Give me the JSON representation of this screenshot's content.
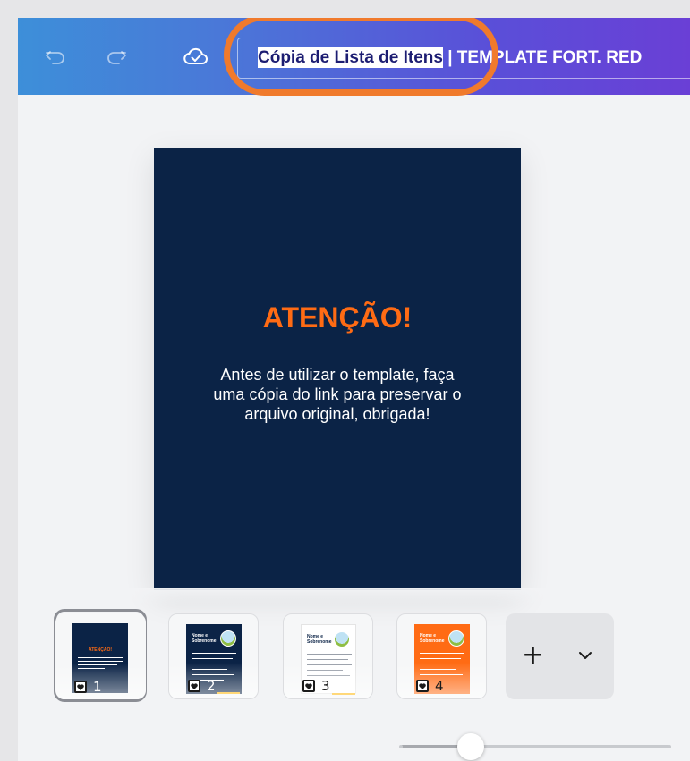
{
  "toolbar": {
    "undo_icon": "undo-icon",
    "redo_icon": "redo-icon",
    "cloud_icon": "cloud-check-icon",
    "title_selected": "Cópia de Lista de Itens",
    "title_rest": " | TEMPLATE FORT. RED"
  },
  "page": {
    "heading": "ATENÇÃO!",
    "body": "Antes de utilizar o template, faça uma cópia do link para preservar o arquivo original, obrigada!"
  },
  "thumbnails": [
    {
      "number": "1",
      "mini_title": "ATENÇÃO!",
      "selected": true
    },
    {
      "number": "2",
      "mini_title": "Nome e Sobrenome"
    },
    {
      "number": "3",
      "mini_title": "Nome e Sobrenome"
    },
    {
      "number": "4",
      "mini_title": "Nome e Sobrenome"
    }
  ],
  "add_page": {
    "plus": "+",
    "chevron_icon": "chevron-down-icon"
  },
  "zoom_slider": {
    "value_fraction": 0.26
  },
  "colors": {
    "accent_orange": "#ff6b14",
    "navy": "#0b2346",
    "annotation": "#f07a2c"
  }
}
